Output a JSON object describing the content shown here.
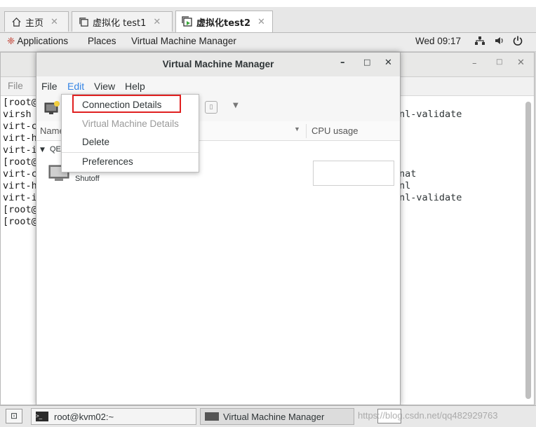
{
  "host_tabs": [
    {
      "label": "主页",
      "active": false,
      "icon": "home-icon"
    },
    {
      "label": "虚拟化 test1",
      "active": false,
      "icon": "window-icon"
    },
    {
      "label": "虚拟化test2",
      "active": true,
      "icon": "vm-running-icon"
    }
  ],
  "gnome_panel": {
    "applications": "Applications",
    "places": "Places",
    "current_app": "Virtual Machine Manager",
    "clock": "Wed 09:17"
  },
  "terminal": {
    "menu": [
      "File"
    ],
    "lines": [
      "[root@",
      "virsh",
      "virt-c",
      "virt-h",
      "virt-i",
      "[root@",
      "virt-c",
      "virt-h",
      "virt-i",
      "[root@",
      "[root@"
    ],
    "right_lines": [
      "nl-validate",
      "nat",
      "nl",
      "nl-validate"
    ]
  },
  "vmm": {
    "title": "Virtual Machine Manager",
    "menu": {
      "file": "File",
      "edit": "Edit",
      "view": "View",
      "help": "Help"
    },
    "columns": {
      "name": "Name",
      "cpu": "CPU usage"
    },
    "connection_label": "QE",
    "vm_status": "Shutoff"
  },
  "edit_menu": {
    "items": [
      {
        "label": "Connection Details",
        "enabled": true,
        "highlighted": true
      },
      {
        "label": "Virtual Machine Details",
        "enabled": false
      },
      {
        "label": "Delete",
        "enabled": true
      },
      {
        "label": "Preferences",
        "enabled": true
      }
    ]
  },
  "taskbar": {
    "terminal_task": "root@kvm02:~",
    "vmm_task": "Virtual Machine Manager",
    "watermark": "https://blog.csdn.net/qq482929763"
  },
  "colors": {
    "highlight_box": "#e02020",
    "active_menu": "#3584e4"
  }
}
